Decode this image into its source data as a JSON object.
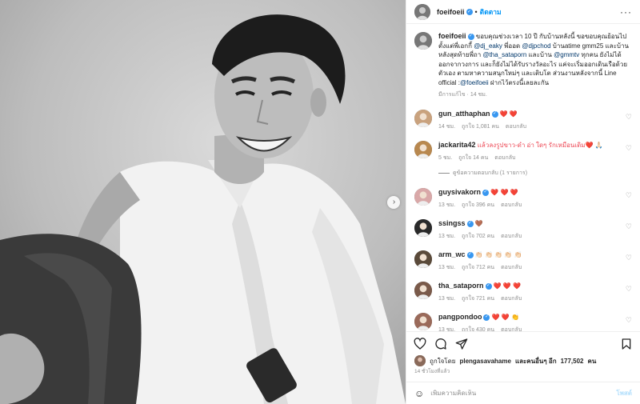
{
  "header": {
    "username": "foeifoeii",
    "follow_label": "ติดตาม",
    "separator": "•",
    "more": "···"
  },
  "caption": {
    "username": "foeifoeii",
    "segments": [
      {
        "t": " ขอบคุณช่วงเวลา 10 ปี กับบ้านหลังนี้ ขอขอบคุณย้อนไปตั้งแต่พี่เอกกี้ "
      },
      {
        "t": "@dj_eaky",
        "m": true
      },
      {
        "t": " พี่ออด "
      },
      {
        "t": "@djpchod",
        "m": true
      },
      {
        "t": " บ้านatime gmm25 และบ้านหลังสุดท้ายพี่ถา "
      },
      {
        "t": "@tha_sataporn",
        "m": true
      },
      {
        "t": " และบ้าน "
      },
      {
        "t": "@gmmtv",
        "m": true
      },
      {
        "t": " ทุกคน ยังไม่ได้ออกจากวงการ และก็ยังไม่ได้รับรางวัลอะไร แค่จะเริ่มออกเดินเรือด้วยตัวเอง ตามหาความสนุกใหม่ๆ และเติบโต ส่วนงานหลังจากนี้ Line official :"
      },
      {
        "t": "@foeifoeii",
        "m": true
      },
      {
        "t": " ฝากไว้ตรงนี้เลยละกัน"
      }
    ],
    "meta": "มีการแก้ไข · 14 ชม."
  },
  "comments": [
    {
      "user": "gun_atthaphan",
      "verified": true,
      "text": " ❤️ ❤️",
      "time": "14 ชม.",
      "likes": "ถูกใจ 1,081 คน",
      "reply": "ตอบกลับ",
      "avatar": "#c9a27e"
    },
    {
      "user": "jackarita42",
      "verified": false,
      "text": " แล้วลงรูปขาว-ดำ อ่า ใดๆ รักเหมือนเดิม❤️ 🙏🏻",
      "time": "5 ชม.",
      "likes": "ถูกใจ 14 คน",
      "reply": "ตอบกลับ",
      "avatar": "#b8884f"
    },
    {
      "user": "guysivakorn",
      "verified": true,
      "text": " ❤️ ❤️ ❤️",
      "time": "13 ชม.",
      "likes": "ถูกใจ 396 คน",
      "reply": "ตอบกลับ",
      "avatar": "#d9a8a8"
    },
    {
      "user": "ssingss",
      "verified": true,
      "text": " 🤎",
      "time": "13 ชม.",
      "likes": "ถูกใจ 702 คน",
      "reply": "ตอบกลับ",
      "avatar": "#2a2a2a"
    },
    {
      "user": "arm_wc",
      "verified": true,
      "text": " 👏🏻 👏🏻 👏🏻 👏🏻 👏🏻",
      "time": "13 ชม.",
      "likes": "ถูกใจ 712 คน",
      "reply": "ตอบกลับ",
      "avatar": "#5a4a3a"
    },
    {
      "user": "tha_sataporn",
      "verified": true,
      "text": " ❤️ ❤️ ❤️",
      "time": "13 ชม.",
      "likes": "ถูกใจ 721 คน",
      "reply": "ตอบกลับ",
      "avatar": "#7a5a4a"
    },
    {
      "user": "pangpondoo",
      "verified": true,
      "text": " ❤️ ❤️ 👏",
      "time": "13 ชม.",
      "likes": "ถูกใจ 430 คน",
      "reply": "ตอบกลับ",
      "avatar": "#9a6a5a"
    }
  ],
  "replies_label": "ดูข้อความตอบกลับ (1 รายการ)",
  "likes": {
    "prefix": "ถูกใจโดย",
    "user": "plengasavahame",
    "mid": "และคนอื่นๆ อีก",
    "count": "177,502",
    "suffix": "คน"
  },
  "ago": "14 ชั่วโมงที่แล้ว",
  "add_comment": {
    "placeholder": "เพิ่มความคิดเห็น",
    "post_label": "โพสต์"
  },
  "icons": [
    "heart-icon",
    "comment-icon",
    "share-icon",
    "bookmark-icon",
    "emoji-icon",
    "chevron-right-icon",
    "more-options-icon",
    "verified-icon"
  ],
  "colors": {
    "accent": "#0095f6",
    "mention": "#00376b",
    "heart": "#ed4956",
    "muted": "#8e8e8e",
    "verified": "#3897f0"
  }
}
